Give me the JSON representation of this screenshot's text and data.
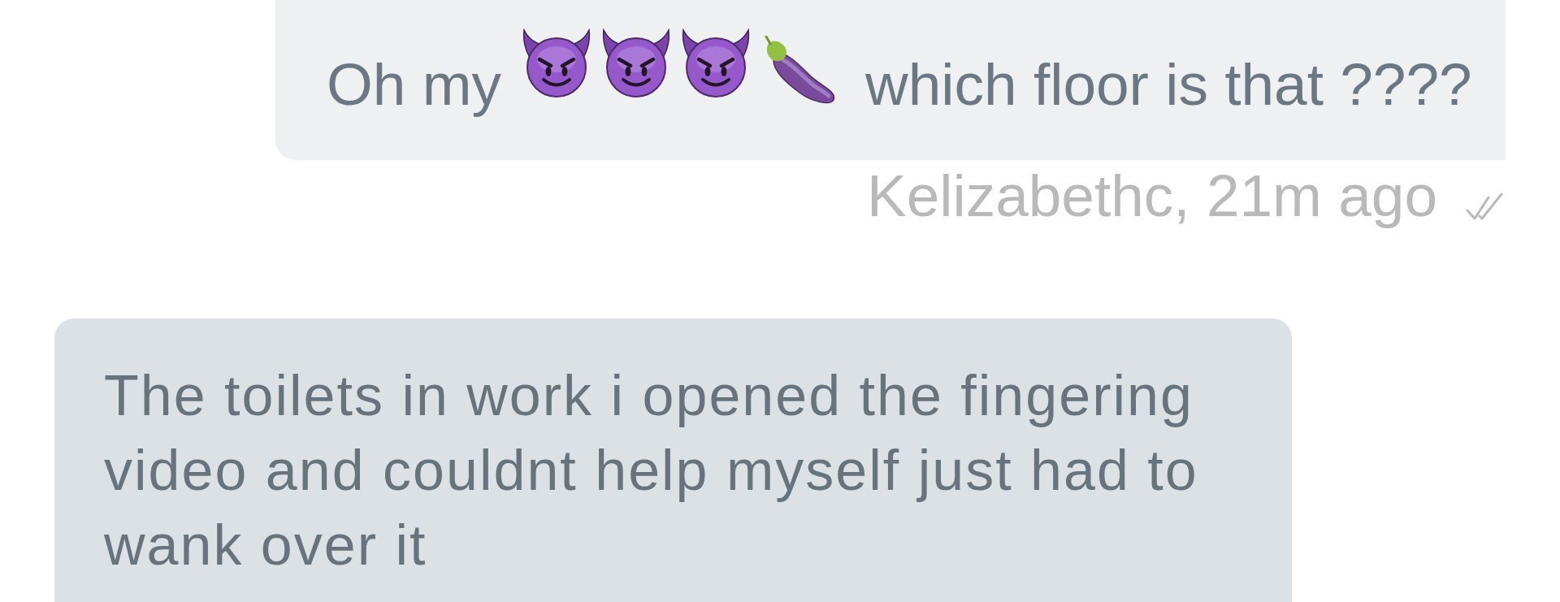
{
  "messages": [
    {
      "kind": "outgoing",
      "parts": [
        {
          "kind": "text",
          "text": "Oh my"
        },
        {
          "kind": "devil"
        },
        {
          "kind": "devil"
        },
        {
          "kind": "devil"
        },
        {
          "kind": "eggplant"
        },
        {
          "kind": "text",
          "text": "which floor is that ????"
        }
      ],
      "meta": "Kelizabethc, 21m ago",
      "read": true
    },
    {
      "kind": "incoming",
      "parts": [
        {
          "kind": "text",
          "text": "The toilets in work i opened the fingering video and couldnt help myself just had to wank over it"
        }
      ]
    }
  ]
}
